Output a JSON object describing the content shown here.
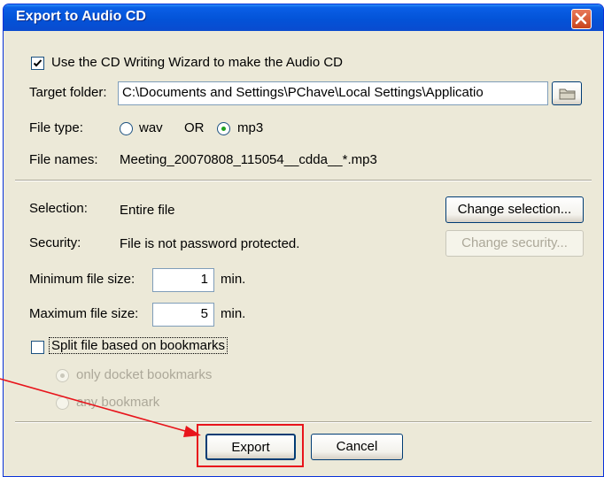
{
  "window": {
    "title": "Export to Audio CD"
  },
  "wizard": {
    "label": "Use the CD Writing Wizard to make the Audio CD",
    "checked": true
  },
  "target": {
    "label": "Target folder:",
    "value": "C:\\Documents and Settings\\PChave\\Local Settings\\Applicatio"
  },
  "filetype": {
    "label": "File type:",
    "opt1": "wav",
    "or": "OR",
    "opt2": "mp3",
    "selected": "mp3"
  },
  "filenames": {
    "label": "File names:",
    "value": "Meeting_20070808_115054__cdda__*.mp3"
  },
  "selection": {
    "label": "Selection:",
    "value": "Entire file",
    "button": "Change selection..."
  },
  "security": {
    "label": "Security:",
    "value": "File is not password protected.",
    "button": "Change security..."
  },
  "minsize": {
    "label": "Minimum file size:",
    "value": "1",
    "unit": "min."
  },
  "maxsize": {
    "label": "Maximum file size:",
    "value": "5",
    "unit": "min."
  },
  "split": {
    "label": "Split file based on bookmarks",
    "checked": false,
    "opt1": "only docket bookmarks",
    "opt2": "any bookmark"
  },
  "buttons": {
    "export": "Export",
    "cancel": "Cancel"
  },
  "colors": {
    "title_bar": "#0a5fe6",
    "dialog_bg": "#ECE9D8",
    "annotation": "#e8141b"
  },
  "icons": [
    "close-icon",
    "checkmark-icon",
    "folder-icon"
  ]
}
